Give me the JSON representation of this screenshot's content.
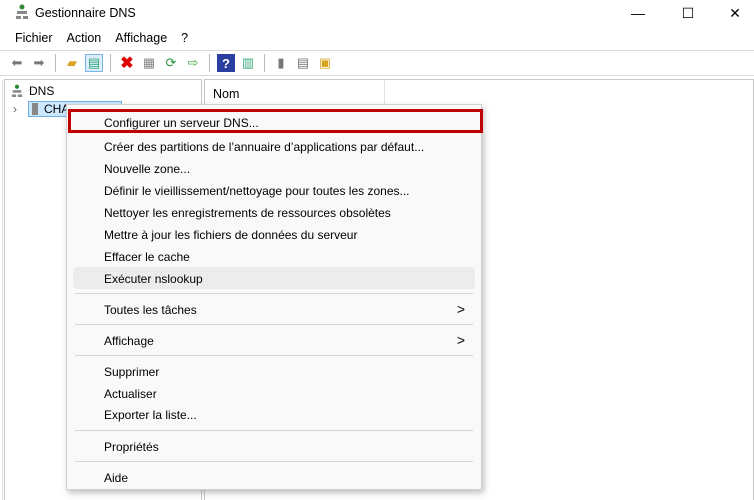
{
  "window": {
    "title": "Gestionnaire DNS",
    "minimize": "—",
    "maximize": "☐",
    "close": "✕"
  },
  "menubar": [
    "Fichier",
    "Action",
    "Affichage",
    "?"
  ],
  "tree": {
    "root": "DNS",
    "server": "CHA-DC-01"
  },
  "list": {
    "column_name": "Nom"
  },
  "context_menu": {
    "items": [
      {
        "label": "Configurer un serveur DNS..."
      },
      {
        "label": "Créer des partitions de l’annuaire d’applications par défaut..."
      },
      {
        "label": "Nouvelle zone..."
      },
      {
        "label": "Définir le vieillissement/nettoyage pour toutes les zones..."
      },
      {
        "label": "Nettoyer les enregistrements de ressources obsolètes"
      },
      {
        "label": "Mettre à jour les fichiers de données du serveur"
      },
      {
        "label": "Effacer le cache"
      },
      {
        "label": "Exécuter nslookup"
      },
      {
        "label": "Toutes les tâches",
        "submenu": ">"
      },
      {
        "label": "Affichage",
        "submenu": ">"
      },
      {
        "label": "Supprimer"
      },
      {
        "label": "Actualiser"
      },
      {
        "label": "Exporter la liste..."
      },
      {
        "label": "Propriétés"
      },
      {
        "label": "Aide"
      }
    ]
  },
  "colors": {
    "highlight": "#c00000",
    "selection": "#cce8ff"
  }
}
